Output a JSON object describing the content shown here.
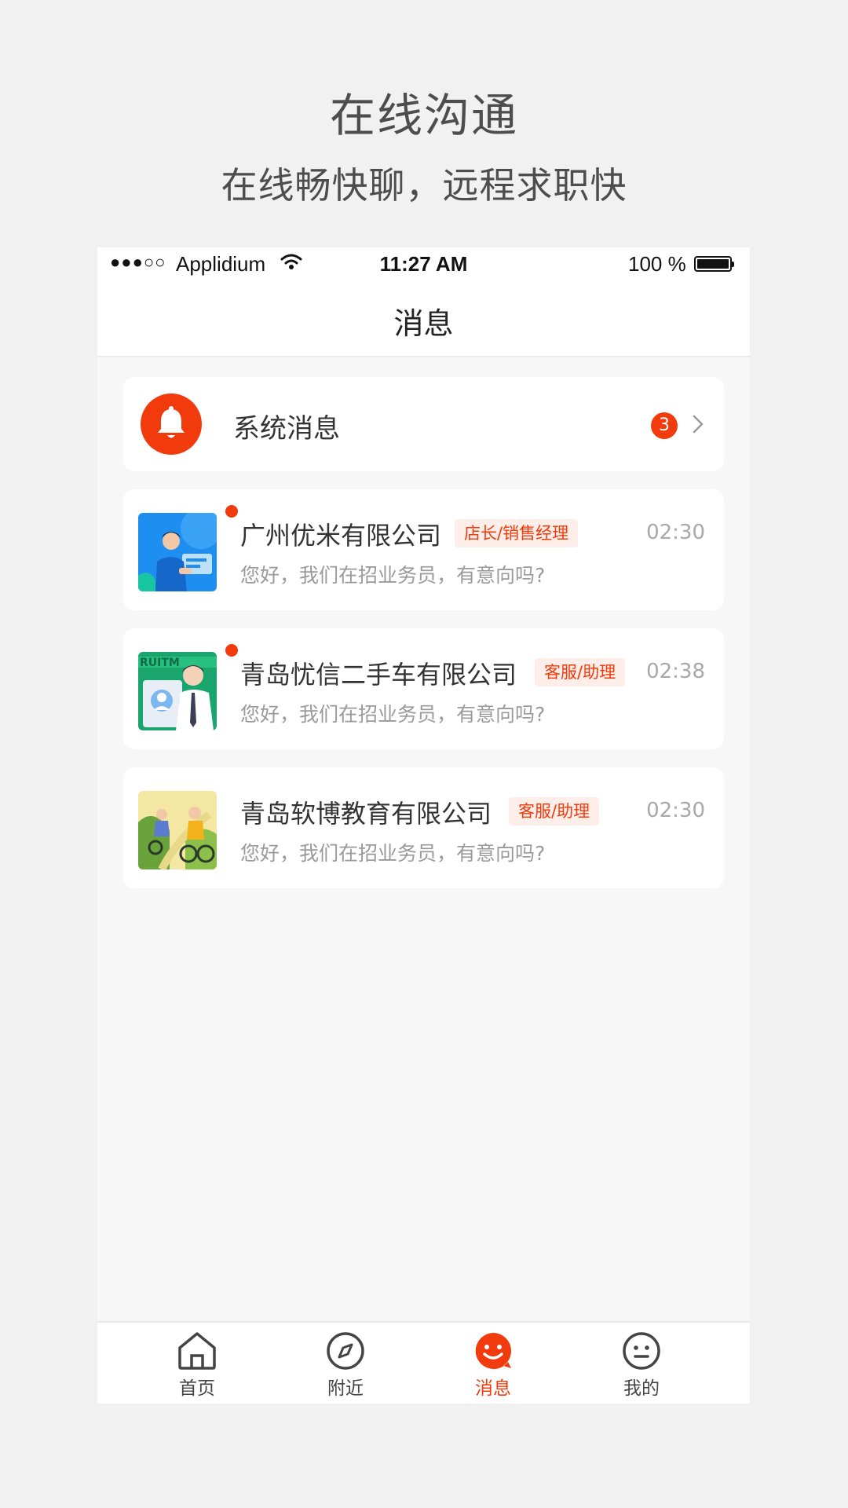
{
  "hero": {
    "title": "在线沟通",
    "subtitle": "在线畅快聊，远程求职快"
  },
  "status_bar": {
    "signal": "●●●○○",
    "carrier": "Applidium",
    "time": "11:27 AM",
    "battery_text": "100 %"
  },
  "nav": {
    "title": "消息"
  },
  "system_message": {
    "label": "系统消息",
    "badge_count": "3",
    "icon": "bell-icon"
  },
  "chats": [
    {
      "company": "广州优米有限公司",
      "role": "店长/销售经理",
      "time": "02:30",
      "preview": "您好，我们在招业务员，有意向吗?",
      "unread": true
    },
    {
      "company": "青岛忧信二手车有限公司",
      "role": "客服/助理",
      "time": "02:38",
      "preview": "您好，我们在招业务员，有意向吗?",
      "unread": true
    },
    {
      "company": "青岛软博教育有限公司",
      "role": "客服/助理",
      "time": "02:30",
      "preview": "您好，我们在招业务员，有意向吗?",
      "unread": false
    }
  ],
  "tabs": [
    {
      "label": "首页",
      "icon": "home-icon",
      "active": false
    },
    {
      "label": "附近",
      "icon": "compass-icon",
      "active": false
    },
    {
      "label": "消息",
      "icon": "message-smile-icon",
      "active": true
    },
    {
      "label": "我的",
      "icon": "profile-face-icon",
      "active": false
    }
  ],
  "colors": {
    "accent": "#f23b0c",
    "tag_bg": "#fdeeea",
    "page_bg": "#f1f1f1",
    "list_bg": "#f7f7f7"
  }
}
